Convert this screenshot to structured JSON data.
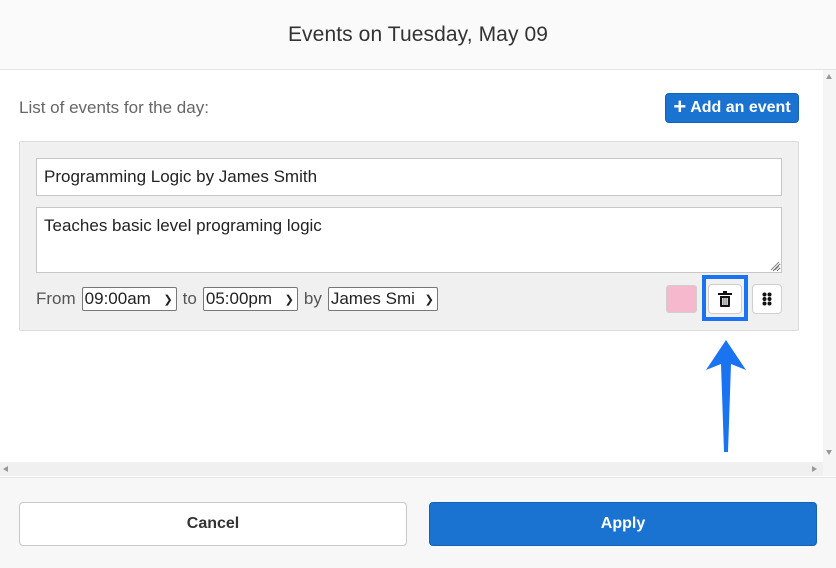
{
  "header": {
    "title": "Events on Tuesday, May 09"
  },
  "list": {
    "label": "List of events for the day:",
    "add_button": {
      "icon": "plus-icon",
      "label": "Add an event"
    }
  },
  "event": {
    "title_value": "Programming Logic by James Smith",
    "description_value": "Teaches basic level programing logic",
    "from_label": "From",
    "from_value": "09:00am",
    "to_label": "to",
    "to_value": "05:00pm",
    "by_label": "by",
    "by_value": "James Smi",
    "color": "#f6b8cd",
    "delete_icon": "trash-icon",
    "drag_icon": "drag-handle-icon"
  },
  "annotation": {
    "highlight_color": "#1a73f0",
    "arrow_icon": "arrow-up-icon"
  },
  "footer": {
    "cancel_label": "Cancel",
    "apply_label": "Apply"
  },
  "colors": {
    "primary": "#1a73d0"
  }
}
